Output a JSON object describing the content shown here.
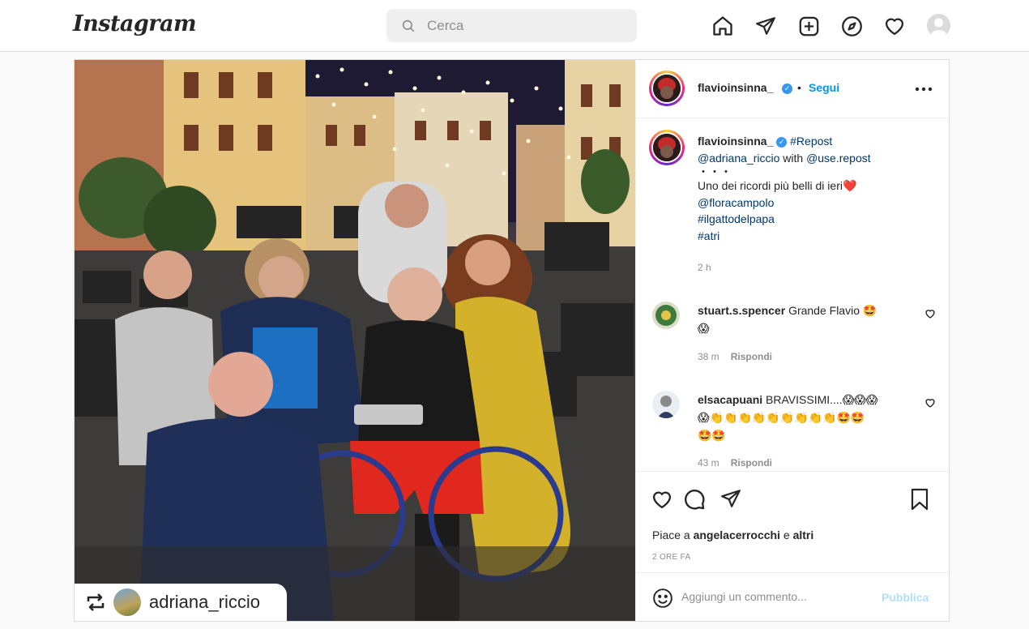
{
  "nav": {
    "logo": "Instagram",
    "search_placeholder": "Cerca",
    "icons": [
      "home-icon",
      "direct-icon",
      "new-post-icon",
      "explore-icon",
      "activity-icon",
      "profile-avatar"
    ]
  },
  "post": {
    "author": "flavioinsinna_",
    "separator": "•",
    "follow_label": "Segui",
    "caption": {
      "username": "flavioinsinna_",
      "repost_tag": "#Repost",
      "mention_1": "@adriana_riccio",
      "with_text": "with",
      "mention_2": "@use.repost",
      "dots": "・・・",
      "line_1": "Uno dei ricordi più belli di ieri",
      "heart": "❤️",
      "mention_3": "@floracampolo",
      "tag_1": "#ilgattodelpapa",
      "tag_2": "#atri",
      "time": "2 h"
    },
    "comments": [
      {
        "user": "stuart.s.spencer",
        "text": "Grande Flavio 🤩",
        "text_2": "😱",
        "time": "38 m",
        "reply": "Rispondi"
      },
      {
        "user": "elsacapuani",
        "text": "BRAVISSIMI....😱😱😱",
        "text_2": "😱👏👏👏👏👏👏👏👏👏🤩🤩",
        "text_3": "🤩🤩",
        "time": "43 m",
        "reply": "Rispondi"
      }
    ],
    "likes_prefix": "Piace a",
    "likes_user": "angelacerrocchi",
    "likes_and": "e",
    "likes_others": "altri",
    "time_ago": "2 ORE FA",
    "add_comment_placeholder": "Aggiungi un commento...",
    "publish_label": "Pubblica",
    "repost_badge_user": "adriana_riccio",
    "colors": {
      "accent": "#0095f6",
      "publish_disabled": "#b2dffc",
      "link": "#00376b",
      "verified": "#3897f0"
    }
  }
}
